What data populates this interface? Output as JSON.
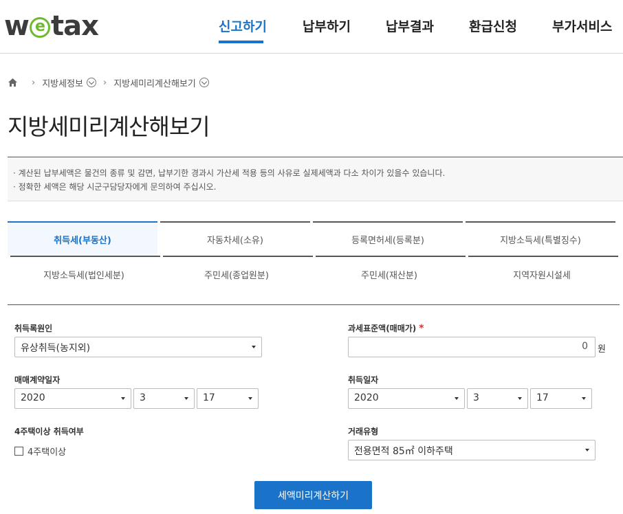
{
  "header": {
    "logo_w": "w",
    "logo_e": "e",
    "logo_tax": "tax",
    "nav": [
      "신고하기",
      "납부하기",
      "납부결과",
      "환급신청",
      "부가서비스"
    ],
    "accent_color": "#1a73c8"
  },
  "breadcrumb": {
    "home_icon": "home-icon",
    "items": [
      "지방세정보",
      "지방세미리계산해보기"
    ]
  },
  "page_title": "지방세미리계산해보기",
  "notice": [
    "· 계산된 납부세액은 물건의 종류 및 감면, 납부기한 경과시 가산세 적용 등의 사유로 실제세액과 다소 차이가 있을수 있습니다.",
    "· 정확한 세액은 해당 시군구담당자에게 문의하여 주십시오."
  ],
  "tabs": [
    "취득세(부동산)",
    "자동차세(소유)",
    "등록면허세(등록분)",
    "지방소득세(특별징수)",
    "지방소득세(법인세분)",
    "주민세(종업원분)",
    "주민세(재산분)",
    "지역자원시설세"
  ],
  "form": {
    "cause_label": "취득록원인",
    "cause_value": "유상취득(농지외)",
    "tax_base_label": "과세표준액(매매가)",
    "required_mark": "*",
    "tax_base_value": "0",
    "tax_base_unit": "원",
    "contract_label": "매매계약일자",
    "contract_year": "2020",
    "contract_month": "3",
    "contract_day": "17",
    "acquire_label": "취득일자",
    "acquire_year": "2020",
    "acquire_month": "3",
    "acquire_day": "17",
    "house4_label": "4주택이상 취득여부",
    "house4_checkbox": "4주택이상",
    "trade_label": "거래유형",
    "trade_value": "전용면적 85㎡ 이하주택"
  },
  "submit_label": "세액미리계산하기"
}
